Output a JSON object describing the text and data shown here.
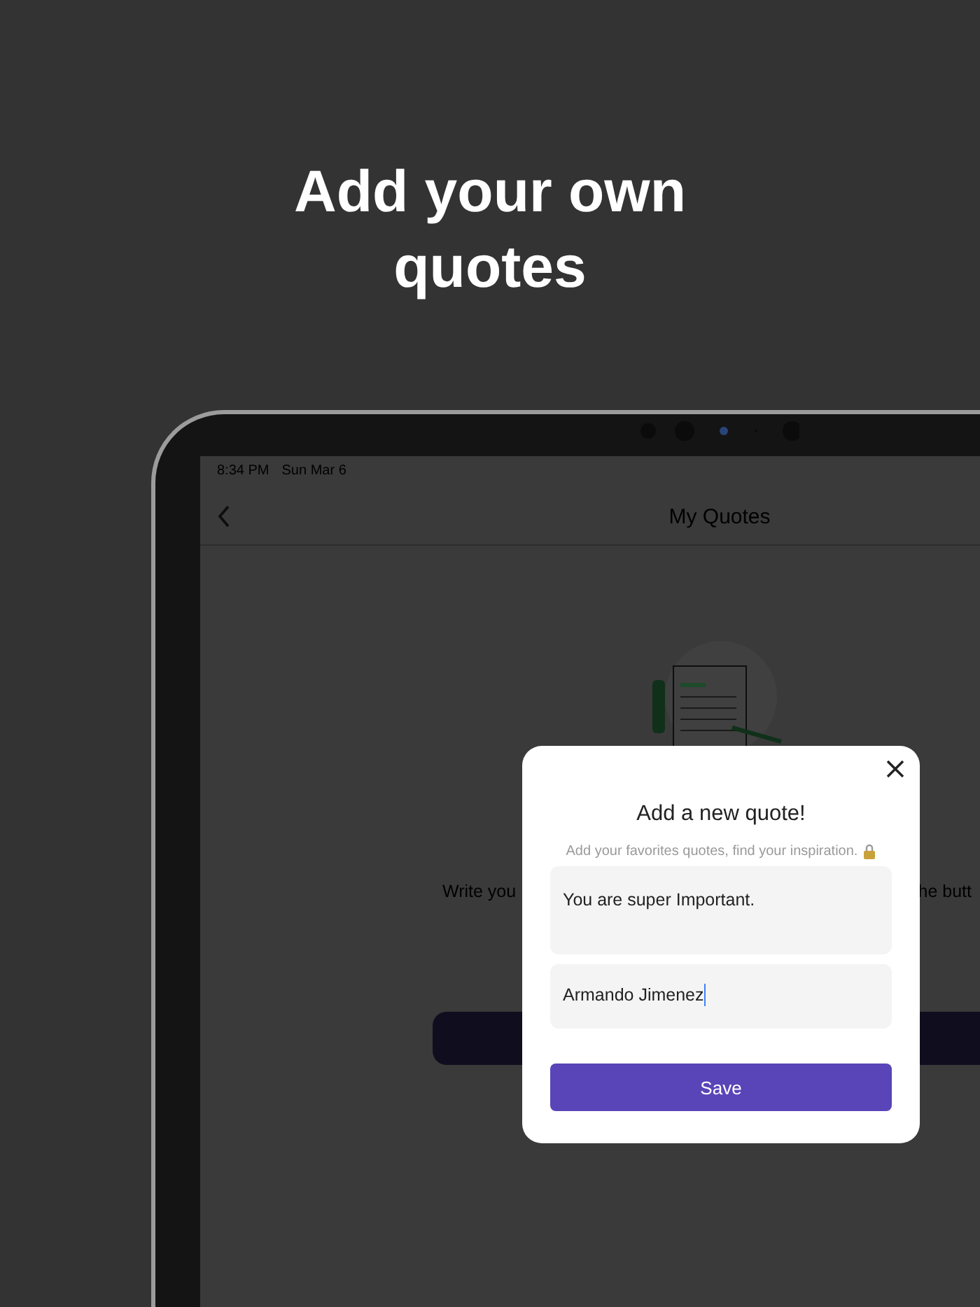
{
  "headline": "Add your own quotes",
  "status_bar": {
    "time": "8:34 PM",
    "date": "Sun Mar 6"
  },
  "nav": {
    "title": "My Quotes"
  },
  "background_texts": [
    "Write you",
    "he butt"
  ],
  "dialog": {
    "title": "Add a new quote!",
    "subtitle": "Add your favorites quotes, find your inspiration.",
    "fields": [
      {
        "kind": "multiline",
        "value": "You are super Important.",
        "focused": false
      },
      {
        "kind": "line",
        "value": "Armando Jimenez",
        "focused": true
      }
    ],
    "button": "Save"
  }
}
